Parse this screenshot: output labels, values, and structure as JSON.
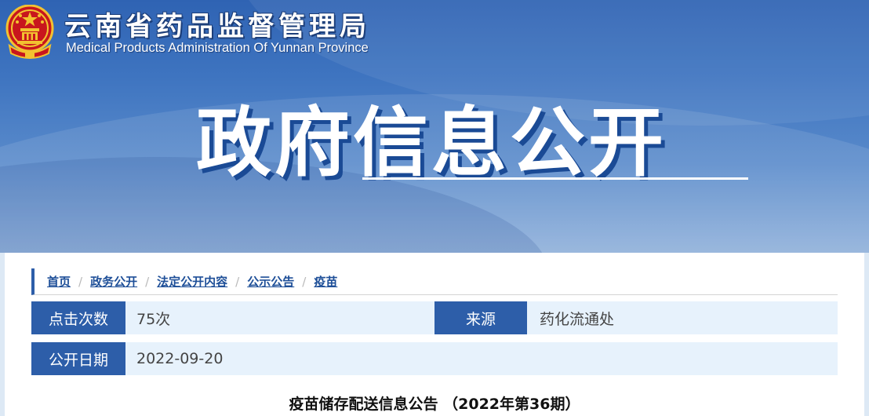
{
  "header": {
    "site_title_cn": "云南省药品监督管理局",
    "site_title_en": "Medical Products Administration Of Yunnan Province",
    "banner_heading": "政府信息公开"
  },
  "breadcrumb": {
    "items": [
      "首页",
      "政务公开",
      "法定公开内容",
      "公示公告",
      "疫苗"
    ],
    "separator": "/"
  },
  "info": {
    "clicks_label": "点击次数",
    "clicks_value": "75次",
    "source_label": "来源",
    "source_value": "药化流通处",
    "date_label": "公开日期",
    "date_value": "2022-09-20"
  },
  "article": {
    "title": "疫苗储存配送信息公告 （2022年第36期）"
  },
  "colors": {
    "banner_top": "#2f63b3",
    "label_bg": "#2d5ea9",
    "row_bg": "#e7f2fc",
    "link": "#1e4f98"
  }
}
